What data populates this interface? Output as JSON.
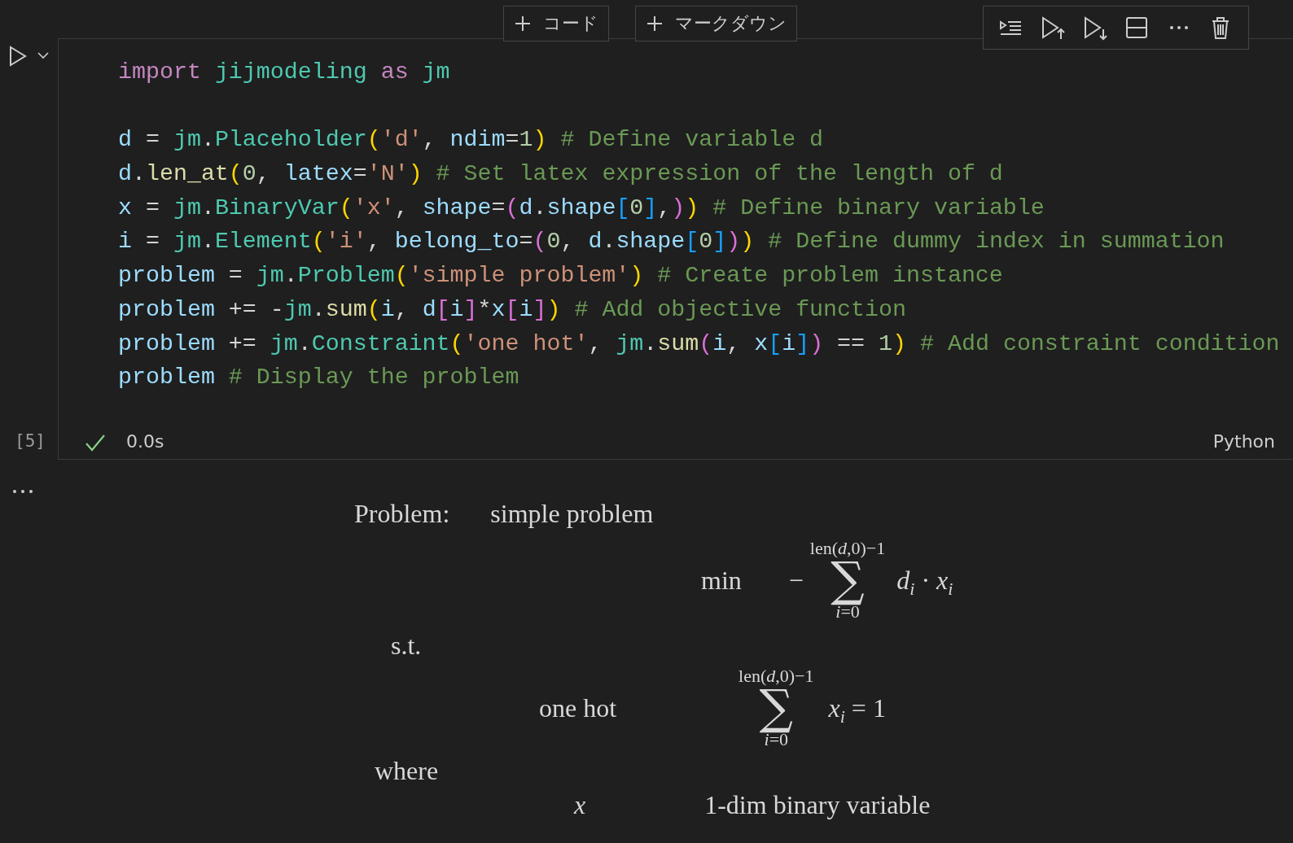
{
  "insert_buttons": [
    {
      "label": "コード"
    },
    {
      "label": "マークダウン"
    }
  ],
  "cell": {
    "blocks": [
      {
        "lines": [
          {
            "tokens": [
              {
                "kind": "kw",
                "text": "import "
              },
              {
                "kind": "mod",
                "text": "jijmodeling "
              },
              {
                "kind": "kw",
                "text": "as "
              },
              {
                "kind": "mod",
                "text": "jm"
              }
            ]
          }
        ]
      },
      {
        "lines": [
          {
            "tokens": [
              {
                "kind": "var",
                "text": "d"
              },
              {
                "kind": "plain",
                "text": " = "
              },
              {
                "kind": "mod",
                "text": "jm"
              },
              {
                "kind": "plain",
                "text": "."
              },
              {
                "kind": "mod",
                "text": "Placeholder"
              },
              {
                "kind": "b1",
                "text": "("
              },
              {
                "kind": "str",
                "text": "'d'"
              },
              {
                "kind": "plain",
                "text": ", "
              },
              {
                "kind": "var",
                "text": "ndim"
              },
              {
                "kind": "plain",
                "text": "="
              },
              {
                "kind": "num",
                "text": "1"
              },
              {
                "kind": "b1",
                "text": ")"
              },
              {
                "kind": "com",
                "text": " # Define variable d"
              }
            ]
          },
          {
            "tokens": [
              {
                "kind": "var",
                "text": "d"
              },
              {
                "kind": "plain",
                "text": "."
              },
              {
                "kind": "fn",
                "text": "len_at"
              },
              {
                "kind": "b1",
                "text": "("
              },
              {
                "kind": "num",
                "text": "0"
              },
              {
                "kind": "plain",
                "text": ", "
              },
              {
                "kind": "var",
                "text": "latex"
              },
              {
                "kind": "plain",
                "text": "="
              },
              {
                "kind": "str",
                "text": "'N'"
              },
              {
                "kind": "b1",
                "text": ")"
              },
              {
                "kind": "com",
                "text": " # Set latex expression of the length of d"
              }
            ]
          },
          {
            "tokens": [
              {
                "kind": "var",
                "text": "x"
              },
              {
                "kind": "plain",
                "text": " = "
              },
              {
                "kind": "mod",
                "text": "jm"
              },
              {
                "kind": "plain",
                "text": "."
              },
              {
                "kind": "mod",
                "text": "BinaryVar"
              },
              {
                "kind": "b1",
                "text": "("
              },
              {
                "kind": "str",
                "text": "'x'"
              },
              {
                "kind": "plain",
                "text": ", "
              },
              {
                "kind": "var",
                "text": "shape"
              },
              {
                "kind": "plain",
                "text": "="
              },
              {
                "kind": "b2",
                "text": "("
              },
              {
                "kind": "var",
                "text": "d"
              },
              {
                "kind": "plain",
                "text": "."
              },
              {
                "kind": "var",
                "text": "shape"
              },
              {
                "kind": "b3",
                "text": "["
              },
              {
                "kind": "num",
                "text": "0"
              },
              {
                "kind": "b3",
                "text": "]"
              },
              {
                "kind": "plain",
                "text": ","
              },
              {
                "kind": "b2",
                "text": ")"
              },
              {
                "kind": "b1",
                "text": ")"
              },
              {
                "kind": "com",
                "text": " # Define binary variable"
              }
            ]
          },
          {
            "tokens": [
              {
                "kind": "var",
                "text": "i"
              },
              {
                "kind": "plain",
                "text": " = "
              },
              {
                "kind": "mod",
                "text": "jm"
              },
              {
                "kind": "plain",
                "text": "."
              },
              {
                "kind": "mod",
                "text": "Element"
              },
              {
                "kind": "b1",
                "text": "("
              },
              {
                "kind": "str",
                "text": "'i'"
              },
              {
                "kind": "plain",
                "text": ", "
              },
              {
                "kind": "var",
                "text": "belong_to"
              },
              {
                "kind": "plain",
                "text": "="
              },
              {
                "kind": "b2",
                "text": "("
              },
              {
                "kind": "num",
                "text": "0"
              },
              {
                "kind": "plain",
                "text": ", "
              },
              {
                "kind": "var",
                "text": "d"
              },
              {
                "kind": "plain",
                "text": "."
              },
              {
                "kind": "var",
                "text": "shape"
              },
              {
                "kind": "b3",
                "text": "["
              },
              {
                "kind": "num",
                "text": "0"
              },
              {
                "kind": "b3",
                "text": "]"
              },
              {
                "kind": "b2",
                "text": ")"
              },
              {
                "kind": "b1",
                "text": ")"
              },
              {
                "kind": "com",
                "text": " # Define dummy index in summation"
              }
            ]
          },
          {
            "tokens": [
              {
                "kind": "var",
                "text": "problem"
              },
              {
                "kind": "plain",
                "text": " = "
              },
              {
                "kind": "mod",
                "text": "jm"
              },
              {
                "kind": "plain",
                "text": "."
              },
              {
                "kind": "mod",
                "text": "Problem"
              },
              {
                "kind": "b1",
                "text": "("
              },
              {
                "kind": "str",
                "text": "'simple problem'"
              },
              {
                "kind": "b1",
                "text": ")"
              },
              {
                "kind": "com",
                "text": " # Create problem instance"
              }
            ]
          },
          {
            "tokens": [
              {
                "kind": "var",
                "text": "problem"
              },
              {
                "kind": "plain",
                "text": " += -"
              },
              {
                "kind": "mod",
                "text": "jm"
              },
              {
                "kind": "plain",
                "text": "."
              },
              {
                "kind": "fn",
                "text": "sum"
              },
              {
                "kind": "b1",
                "text": "("
              },
              {
                "kind": "var",
                "text": "i"
              },
              {
                "kind": "plain",
                "text": ", "
              },
              {
                "kind": "var",
                "text": "d"
              },
              {
                "kind": "b2",
                "text": "["
              },
              {
                "kind": "var",
                "text": "i"
              },
              {
                "kind": "b2",
                "text": "]"
              },
              {
                "kind": "plain",
                "text": "*"
              },
              {
                "kind": "var",
                "text": "x"
              },
              {
                "kind": "b2",
                "text": "["
              },
              {
                "kind": "var",
                "text": "i"
              },
              {
                "kind": "b2",
                "text": "]"
              },
              {
                "kind": "b1",
                "text": ")"
              },
              {
                "kind": "com",
                "text": " # Add objective function"
              }
            ]
          },
          {
            "tokens": [
              {
                "kind": "var",
                "text": "problem"
              },
              {
                "kind": "plain",
                "text": " += "
              },
              {
                "kind": "mod",
                "text": "jm"
              },
              {
                "kind": "plain",
                "text": "."
              },
              {
                "kind": "mod",
                "text": "Constraint"
              },
              {
                "kind": "b1",
                "text": "("
              },
              {
                "kind": "str",
                "text": "'one hot'"
              },
              {
                "kind": "plain",
                "text": ", "
              },
              {
                "kind": "mod",
                "text": "jm"
              },
              {
                "kind": "plain",
                "text": "."
              },
              {
                "kind": "fn",
                "text": "sum"
              },
              {
                "kind": "b2",
                "text": "("
              },
              {
                "kind": "var",
                "text": "i"
              },
              {
                "kind": "plain",
                "text": ", "
              },
              {
                "kind": "var",
                "text": "x"
              },
              {
                "kind": "b3",
                "text": "["
              },
              {
                "kind": "var",
                "text": "i"
              },
              {
                "kind": "b3",
                "text": "]"
              },
              {
                "kind": "b2",
                "text": ")"
              },
              {
                "kind": "plain",
                "text": " == "
              },
              {
                "kind": "num",
                "text": "1"
              },
              {
                "kind": "b1",
                "text": ")"
              },
              {
                "kind": "com",
                "text": " # Add constraint condition"
              }
            ]
          },
          {
            "tokens": [
              {
                "kind": "var",
                "text": "problem"
              },
              {
                "kind": "com",
                "text": " # Display the problem"
              }
            ]
          }
        ]
      }
    ],
    "execution_count": "[5]",
    "succeeded": true,
    "duration": "0.0s",
    "language": "Python"
  },
  "output": {
    "problem_label": "Problem:",
    "problem_name": "simple problem",
    "objective": {
      "sense": "min",
      "sign": "−",
      "operator": "∑",
      "sum_upper": "len(*d*,0)−1",
      "sum_lower": "*i*=0",
      "term": "*d*$_{i}$ · *x*$_{i}$"
    },
    "constraints_label": "s.t.",
    "constraints": [
      {
        "name": "one hot",
        "operator": "∑",
        "sum_upper": "len(*d*,0)−1",
        "sum_lower": "*i*=0",
        "expression": "*x*$_{i}$ = 1"
      }
    ],
    "where_label": "where",
    "decision_variables": [
      {
        "symbol": "x",
        "description": "1-dim binary variable"
      }
    ]
  }
}
